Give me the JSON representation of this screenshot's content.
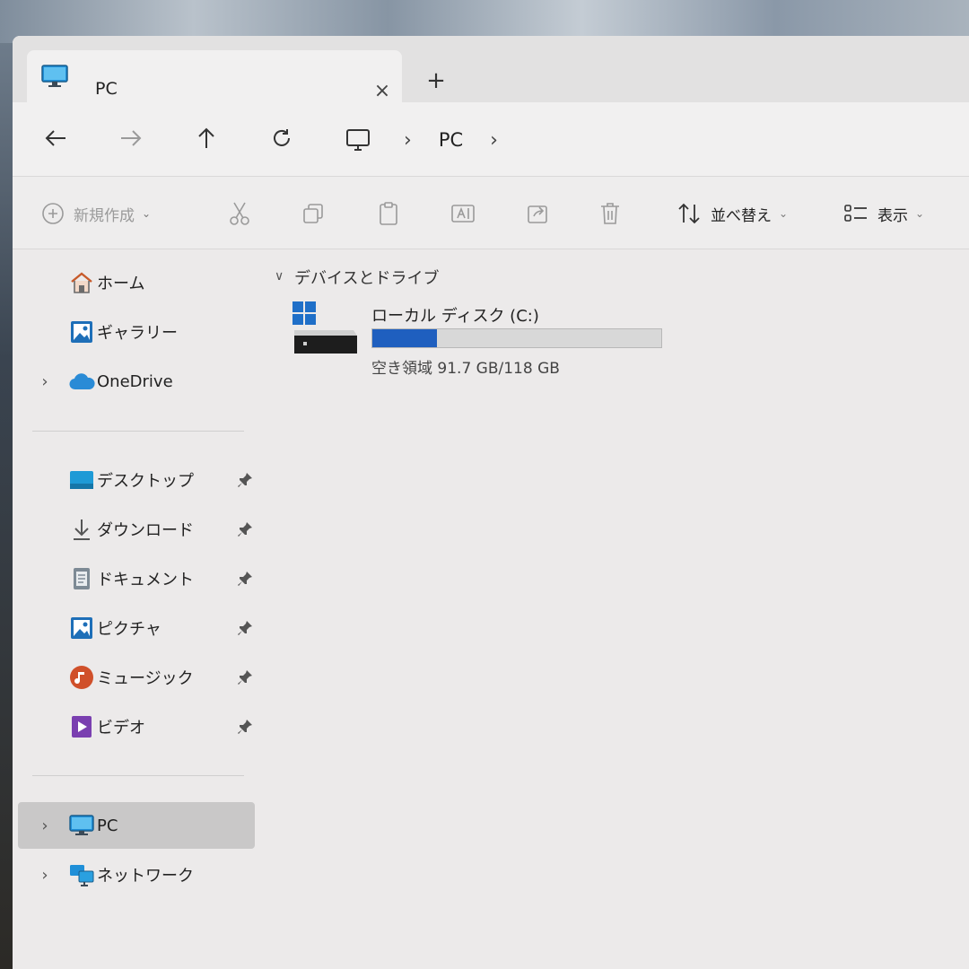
{
  "tab": {
    "title": "PC",
    "close_glyph": "×",
    "new_glyph": "+"
  },
  "breadcrumb": {
    "location": "PC",
    "chevron": "›"
  },
  "commands": {
    "new_label": "新規作成",
    "sort_label": "並べ替え",
    "view_label": "表示"
  },
  "sidebar": {
    "top_items": [
      {
        "label": "ホーム",
        "icon": "home-icon"
      },
      {
        "label": "ギャラリー",
        "icon": "gallery-icon"
      },
      {
        "label": "OneDrive",
        "icon": "cloud-icon",
        "expandable": true
      }
    ],
    "quick_access": [
      {
        "label": "デスクトップ",
        "icon": "desktop-icon",
        "pinned": true
      },
      {
        "label": "ダウンロード",
        "icon": "download-icon",
        "pinned": true
      },
      {
        "label": "ドキュメント",
        "icon": "document-icon",
        "pinned": true
      },
      {
        "label": "ピクチャ",
        "icon": "picture-icon",
        "pinned": true
      },
      {
        "label": "ミュージック",
        "icon": "music-icon",
        "pinned": true
      },
      {
        "label": "ビデオ",
        "icon": "video-icon",
        "pinned": true
      }
    ],
    "bottom_items": [
      {
        "label": "PC",
        "icon": "pc-icon",
        "expandable": true,
        "selected": true
      },
      {
        "label": "ネットワーク",
        "icon": "network-icon",
        "expandable": true
      }
    ],
    "expand_glyph": "›"
  },
  "content": {
    "group_title": "デバイスとドライブ",
    "drives": [
      {
        "name": "ローカル ディスク (C:)",
        "free_text": "空き領域 91.7 GB/118 GB",
        "used_fraction": 0.223
      }
    ]
  },
  "colors": {
    "accent": "#1f5fbf",
    "selected_bg": "#c9c8c8"
  }
}
